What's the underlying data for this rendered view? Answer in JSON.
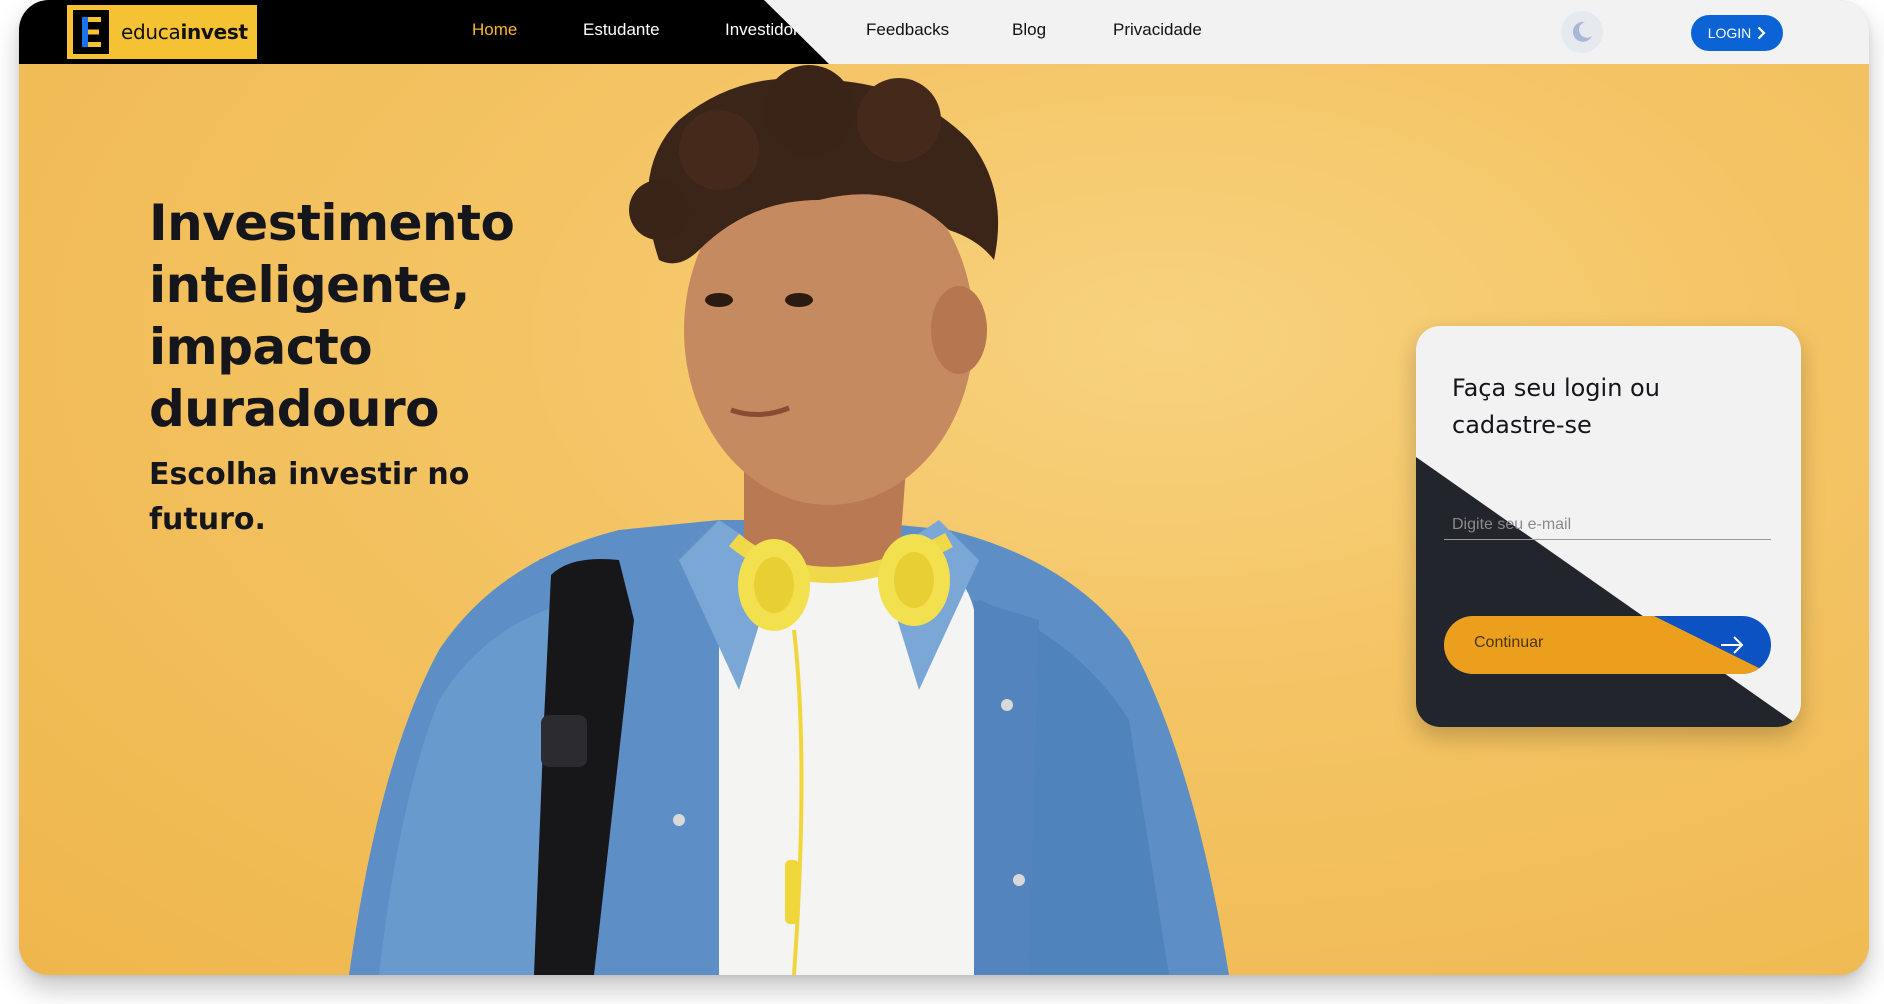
{
  "brand": {
    "name_prefix": "educa",
    "name_suffix": "invest",
    "logo_letter": "E"
  },
  "nav": {
    "items": [
      {
        "label": "Home",
        "active": true
      },
      {
        "label": "Estudante",
        "active": false
      },
      {
        "label": "Investidor",
        "active": false
      },
      {
        "label": "Feedbacks",
        "active": false
      },
      {
        "label": "Blog",
        "active": false
      },
      {
        "label": "Privacidade",
        "active": false
      }
    ],
    "theme_icon": "moon-icon",
    "login_label": "LOGIN"
  },
  "hero": {
    "headline": "Investimento inteligente, impacto duradouro",
    "subline": "Escolha investir no futuro."
  },
  "login_card": {
    "title": "Faça seu login ou cadastre-se",
    "email_placeholder": "Digite seu e-mail",
    "continue_label": "Continuar"
  },
  "colors": {
    "hero_background": "#f4c361",
    "brand_yellow": "#f5c234",
    "accent_orange": "#ec9f1c",
    "accent_blue": "#0b63d6",
    "nav_dark": "#000000",
    "card_dark": "#22252c"
  }
}
